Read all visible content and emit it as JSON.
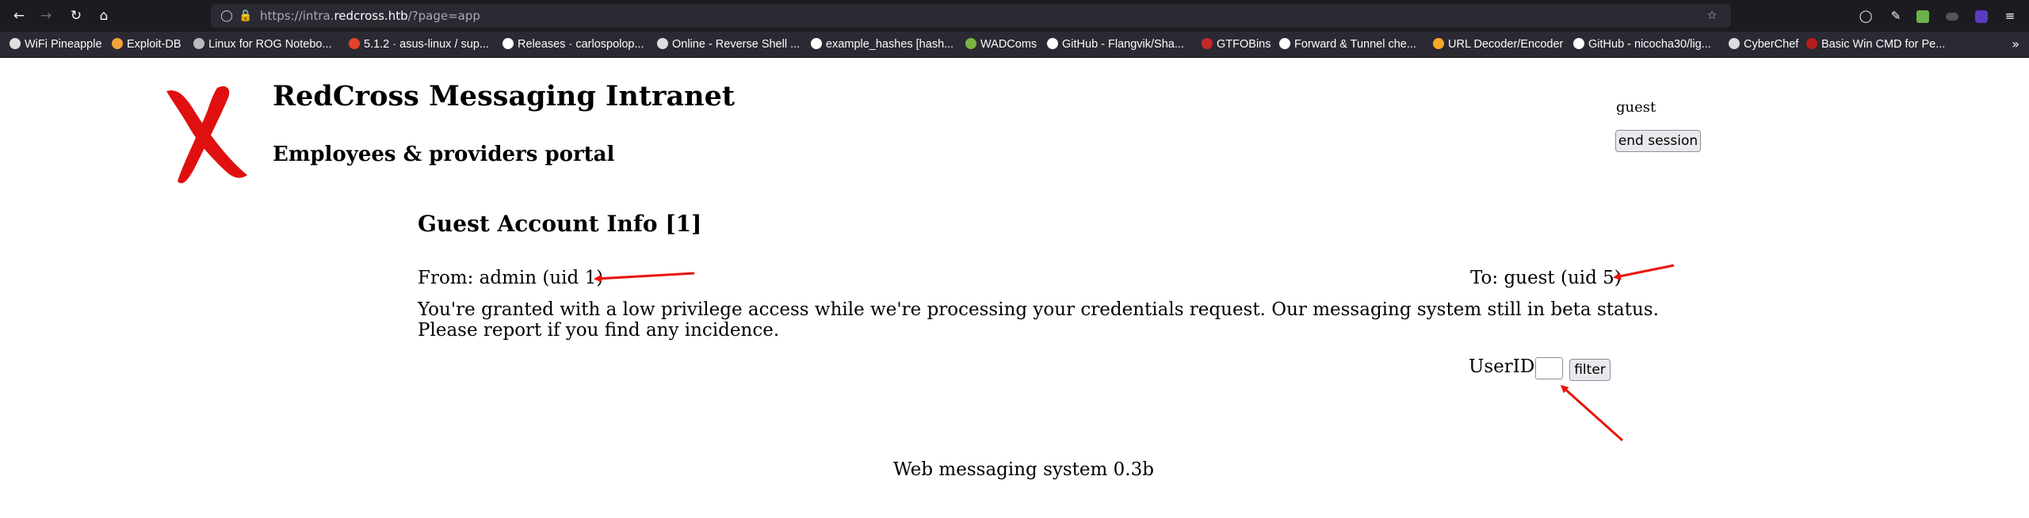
{
  "browser": {
    "url_prefix": "https://intra.",
    "url_domain": "redcross.htb",
    "url_suffix": "/?page=app",
    "bookmarks": [
      {
        "label": "WiFi Pineapple",
        "color": "#e0e0e0"
      },
      {
        "label": "Exploit-DB",
        "color": "#f2a33a"
      },
      {
        "label": "Linux for ROG Notebo...",
        "color": "#bbbbbb"
      },
      {
        "label": "5.1.2 · asus-linux / sup...",
        "color": "#e24329"
      },
      {
        "label": "Releases · carlospolop...",
        "color": "#ffffff"
      },
      {
        "label": "Online - Reverse Shell ...",
        "color": "#dddddd"
      },
      {
        "label": "example_hashes [hash...",
        "color": "#ffffff"
      },
      {
        "label": "WADComs",
        "color": "#7cb342"
      },
      {
        "label": "GitHub - Flangvik/Sha...",
        "color": "#ffffff"
      },
      {
        "label": "GTFOBins",
        "color": "#c62828"
      },
      {
        "label": "Forward & Tunnel che...",
        "color": "#ffffff"
      },
      {
        "label": "URL Decoder/Encoder",
        "color": "#f9a825"
      },
      {
        "label": "GitHub - nicocha30/lig...",
        "color": "#ffffff"
      },
      {
        "label": "CyberChef",
        "color": "#dddddd"
      },
      {
        "label": "Basic Win CMD for Pe...",
        "color": "#b71c1c"
      }
    ]
  },
  "header": {
    "title": "RedCross Messaging Intranet",
    "subtitle": "Employees & providers portal",
    "logo_color": "#e01010"
  },
  "user": {
    "name": "guest",
    "end_session_label": "end session"
  },
  "message": {
    "title": "Guest Account Info [1]",
    "from": "From: admin (uid 1)",
    "to": "To: guest (uid 5)",
    "body_line1": "You're granted with a low privilege access while we're processing your credentials request. Our messaging system still in beta status.",
    "body_line2": "Please report if you find any incidence."
  },
  "filter": {
    "label": "UserID",
    "input_value": "",
    "button_label": "filter"
  },
  "footer": {
    "text": "Web messaging system 0.3b"
  },
  "annotation_color": "#e8140c"
}
